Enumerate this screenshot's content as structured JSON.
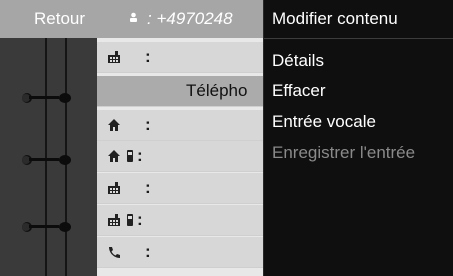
{
  "header": {
    "back_label": "Retour",
    "phone_number": ": +4970248"
  },
  "contact_rows": [
    {
      "icon": "office-icon",
      "icon2": "",
      "text": ":"
    },
    {
      "icon": "",
      "icon2": "",
      "text": "Télépho"
    },
    {
      "icon": "home-icon",
      "icon2": "",
      "text": ":"
    },
    {
      "icon": "home-icon",
      "icon2": "mobile-icon",
      "text": ":"
    },
    {
      "icon": "office-icon",
      "icon2": "",
      "text": ":"
    },
    {
      "icon": "office-icon",
      "icon2": "mobile-icon",
      "text": ":"
    },
    {
      "icon": "phone-icon",
      "icon2": "",
      "text": ":"
    }
  ],
  "menu": {
    "title": "Modifier contenu",
    "items": [
      {
        "label": "Détails",
        "enabled": true
      },
      {
        "label": "Effacer",
        "enabled": true
      },
      {
        "label": "Entrée vocale",
        "enabled": true
      },
      {
        "label": "Enregistrer l'entrée",
        "enabled": false
      }
    ]
  },
  "colors": {
    "menu_background": "#0f0f0f",
    "header_background": "#a6a6a6",
    "selected_row": "#ababab",
    "disabled_text": "#8a8a8a"
  }
}
